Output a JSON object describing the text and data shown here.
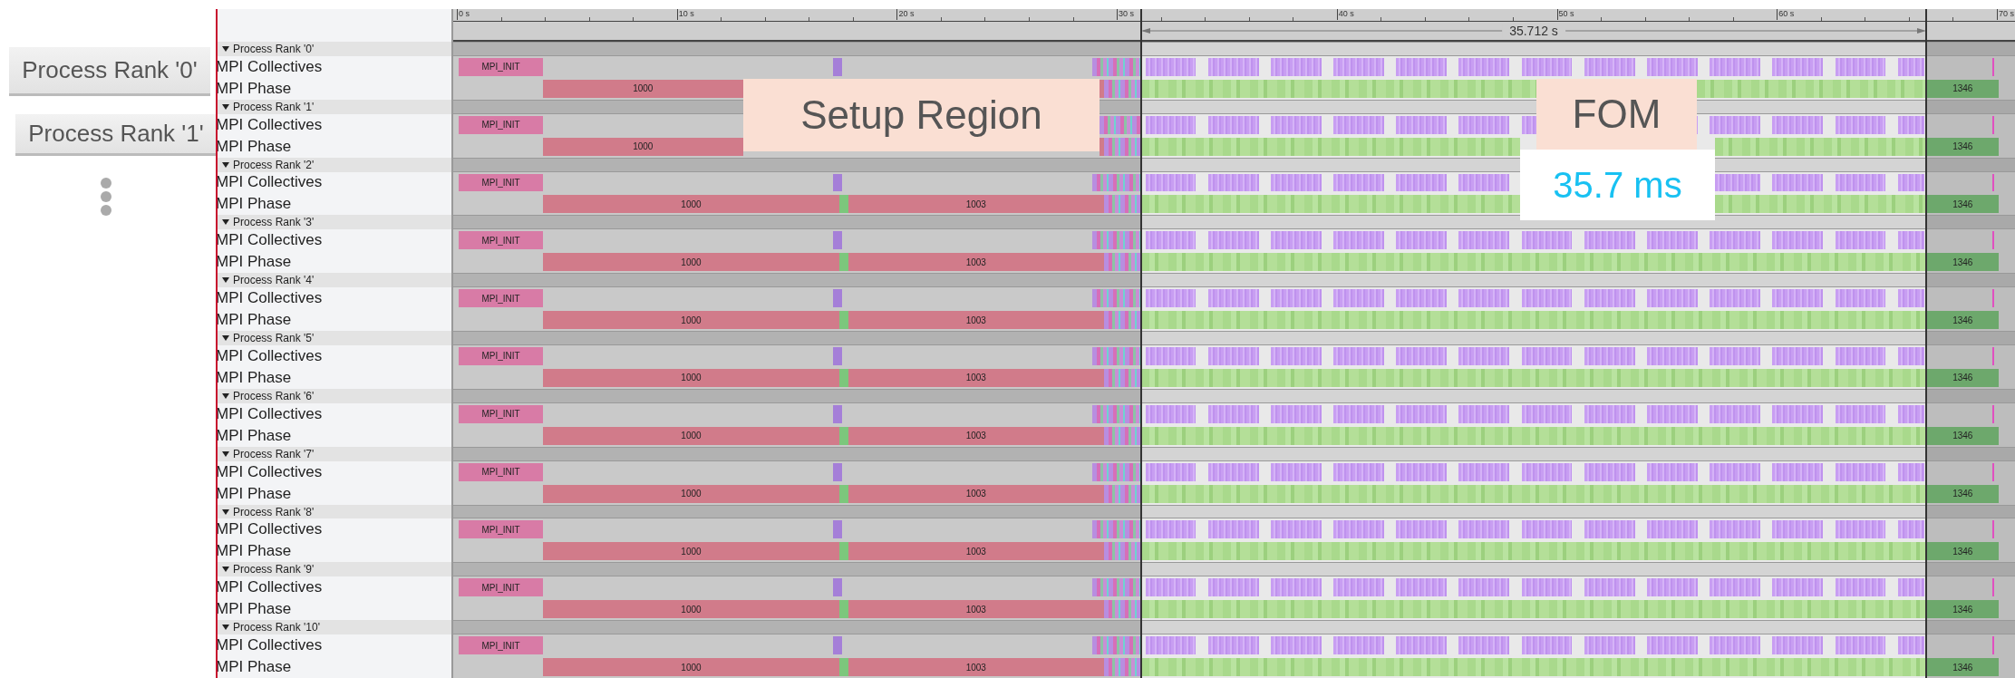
{
  "notes": {
    "rank_labels": [
      "Process Rank '0'",
      "Process Rank '1'"
    ]
  },
  "ruler": {
    "ticks": [
      "0 s",
      "10 s",
      "20 s",
      "30 s",
      "40 s",
      "50 s",
      "60 s",
      "70 s"
    ],
    "duration": "35.712 s"
  },
  "ranks": [
    {
      "label": "Process Rank '0'",
      "expanded": true,
      "tracks": [
        {
          "kind": "collectives",
          "name": "MPI Collectives",
          "slices": [
            {
              "kind": "init",
              "label": "MPI_INIT"
            }
          ]
        },
        {
          "kind": "phase",
          "name": "MPI Phase",
          "slices": [
            {
              "kind": "phase-a",
              "label": "1000"
            },
            {
              "kind": "phase-b"
            },
            {
              "kind": "final",
              "label": "1346"
            }
          ]
        }
      ]
    },
    {
      "label": "Process Rank '1'",
      "expanded": true,
      "tracks": [
        {
          "kind": "collectives",
          "name": "MPI Collectives",
          "slices": [
            {
              "kind": "init",
              "label": "MPI_INIT"
            }
          ]
        },
        {
          "kind": "phase",
          "name": "MPI Phase",
          "slices": [
            {
              "kind": "phase-a",
              "label": "1000"
            },
            {
              "kind": "phase-b"
            },
            {
              "kind": "final",
              "label": "1346"
            }
          ]
        }
      ]
    },
    {
      "label": "Process Rank '2'",
      "expanded": true,
      "tracks": [
        {
          "kind": "collectives",
          "name": "MPI Collectives",
          "slices": [
            {
              "kind": "init",
              "label": "MPI_INIT"
            }
          ]
        },
        {
          "kind": "phase",
          "name": "MPI Phase",
          "slices": [
            {
              "kind": "phase-a",
              "label": "1000"
            },
            {
              "kind": "phase-b",
              "label": "1003"
            },
            {
              "kind": "final",
              "label": "1346"
            }
          ]
        }
      ]
    },
    {
      "label": "Process Rank '3'",
      "expanded": true,
      "tracks": [
        {
          "kind": "collectives",
          "name": "MPI Collectives",
          "slices": [
            {
              "kind": "init",
              "label": "MPI_INIT"
            }
          ]
        },
        {
          "kind": "phase",
          "name": "MPI Phase",
          "slices": [
            {
              "kind": "phase-a",
              "label": "1000"
            },
            {
              "kind": "phase-b",
              "label": "1003"
            },
            {
              "kind": "final",
              "label": "1346"
            }
          ]
        }
      ]
    },
    {
      "label": "Process Rank '4'",
      "expanded": true,
      "tracks": [
        {
          "kind": "collectives",
          "name": "MPI Collectives",
          "slices": [
            {
              "kind": "init",
              "label": "MPI_INIT"
            }
          ]
        },
        {
          "kind": "phase",
          "name": "MPI Phase",
          "slices": [
            {
              "kind": "phase-a",
              "label": "1000"
            },
            {
              "kind": "phase-b",
              "label": "1003"
            },
            {
              "kind": "final",
              "label": "1346"
            }
          ]
        }
      ]
    },
    {
      "label": "Process Rank '5'",
      "expanded": true,
      "tracks": [
        {
          "kind": "collectives",
          "name": "MPI Collectives",
          "slices": [
            {
              "kind": "init",
              "label": "MPI_INIT"
            }
          ]
        },
        {
          "kind": "phase",
          "name": "MPI Phase",
          "slices": [
            {
              "kind": "phase-a",
              "label": "1000"
            },
            {
              "kind": "phase-b",
              "label": "1003"
            },
            {
              "kind": "final",
              "label": "1346"
            }
          ]
        }
      ]
    },
    {
      "label": "Process Rank '6'",
      "expanded": true,
      "tracks": [
        {
          "kind": "collectives",
          "name": "MPI Collectives",
          "slices": [
            {
              "kind": "init",
              "label": "MPI_INIT"
            }
          ]
        },
        {
          "kind": "phase",
          "name": "MPI Phase",
          "slices": [
            {
              "kind": "phase-a",
              "label": "1000"
            },
            {
              "kind": "phase-b",
              "label": "1003"
            },
            {
              "kind": "final",
              "label": "1346"
            }
          ]
        }
      ]
    },
    {
      "label": "Process Rank '7'",
      "expanded": true,
      "tracks": [
        {
          "kind": "collectives",
          "name": "MPI Collectives",
          "slices": [
            {
              "kind": "init",
              "label": "MPI_INIT"
            }
          ]
        },
        {
          "kind": "phase",
          "name": "MPI Phase",
          "slices": [
            {
              "kind": "phase-a",
              "label": "1000"
            },
            {
              "kind": "phase-b",
              "label": "1003"
            },
            {
              "kind": "final",
              "label": "1346"
            }
          ]
        }
      ]
    },
    {
      "label": "Process Rank '8'",
      "expanded": true,
      "tracks": [
        {
          "kind": "collectives",
          "name": "MPI Collectives",
          "slices": [
            {
              "kind": "init",
              "label": "MPI_INIT"
            }
          ]
        },
        {
          "kind": "phase",
          "name": "MPI Phase",
          "slices": [
            {
              "kind": "phase-a",
              "label": "1000"
            },
            {
              "kind": "phase-b",
              "label": "1003"
            },
            {
              "kind": "final",
              "label": "1346"
            }
          ]
        }
      ]
    },
    {
      "label": "Process Rank '9'",
      "expanded": true,
      "tracks": [
        {
          "kind": "collectives",
          "name": "MPI Collectives",
          "slices": [
            {
              "kind": "init",
              "label": "MPI_INIT"
            }
          ]
        },
        {
          "kind": "phase",
          "name": "MPI Phase",
          "slices": [
            {
              "kind": "phase-a",
              "label": "1000"
            },
            {
              "kind": "phase-b",
              "label": "1003"
            },
            {
              "kind": "final",
              "label": "1346"
            }
          ]
        }
      ]
    },
    {
      "label": "Process Rank '10'",
      "expanded": true,
      "tracks": [
        {
          "kind": "collectives",
          "name": "MPI Collectives",
          "slices": [
            {
              "kind": "init",
              "label": "MPI_INIT"
            }
          ]
        },
        {
          "kind": "phase",
          "name": "MPI Phase",
          "slices": [
            {
              "kind": "phase-a",
              "label": "1000"
            },
            {
              "kind": "phase-b",
              "label": "1003"
            },
            {
              "kind": "final",
              "label": "1346"
            }
          ]
        }
      ]
    }
  ],
  "annotations": [
    {
      "kind": "region",
      "text": "Setup Region"
    },
    {
      "kind": "metric",
      "text": "FOM",
      "value": "35.7 ms"
    }
  ]
}
